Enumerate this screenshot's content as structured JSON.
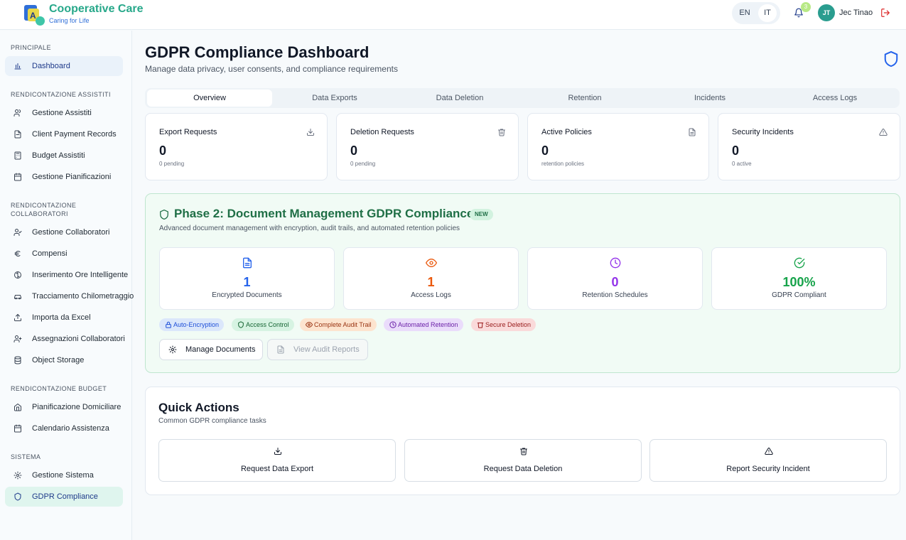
{
  "header": {
    "brand": "Cooperative Care",
    "tagline": "Caring for Life",
    "logo_letter": "A",
    "lang_en": "EN",
    "lang_it": "IT",
    "notification_count": "3",
    "user_initials": "JT",
    "user_name": "Jec Tinao"
  },
  "sidebar": {
    "sections": [
      {
        "label": "PRINCIPALE"
      },
      {
        "label": "RENDICONTAZIONE ASSISTITI"
      },
      {
        "label": "RENDICONTAZIONE COLLABORATORI"
      },
      {
        "label": "RENDICONTAZIONE BUDGET"
      },
      {
        "label": "SISTEMA"
      }
    ],
    "items": [
      {
        "label": "Dashboard",
        "icon": "bar-chart-icon"
      },
      {
        "label": "Gestione Assistiti",
        "icon": "users-icon"
      },
      {
        "label": "Client Payment Records",
        "icon": "file-icon"
      },
      {
        "label": "Budget Assistiti",
        "icon": "calculator-icon"
      },
      {
        "label": "Gestione Pianificazioni",
        "icon": "calendar-icon"
      },
      {
        "label": "Gestione Collaboratori",
        "icon": "user-check-icon"
      },
      {
        "label": "Compensi",
        "icon": "euro-icon"
      },
      {
        "label": "Inserimento Ore Intelligente",
        "icon": "brain-icon"
      },
      {
        "label": "Tracciamento Chilometraggio",
        "icon": "car-icon"
      },
      {
        "label": "Importa da Excel",
        "icon": "upload-icon"
      },
      {
        "label": "Assegnazioni Collaboratori",
        "icon": "user-plus-icon"
      },
      {
        "label": "Object Storage",
        "icon": "database-icon"
      },
      {
        "label": "Pianificazione Domiciliare",
        "icon": "home-icon"
      },
      {
        "label": "Calendario Assistenza",
        "icon": "calendar-icon"
      },
      {
        "label": "Gestione Sistema",
        "icon": "gear-icon"
      },
      {
        "label": "GDPR Compliance",
        "icon": "shield-icon"
      }
    ]
  },
  "page": {
    "title": "GDPR Compliance Dashboard",
    "subtitle": "Manage data privacy, user consents, and compliance requirements"
  },
  "tabs": [
    {
      "label": "Overview"
    },
    {
      "label": "Data Exports"
    },
    {
      "label": "Data Deletion"
    },
    {
      "label": "Retention"
    },
    {
      "label": "Incidents"
    },
    {
      "label": "Access Logs"
    }
  ],
  "stats": [
    {
      "title": "Export Requests",
      "value": "0",
      "sub": "0 pending",
      "icon": "download-icon"
    },
    {
      "title": "Deletion Requests",
      "value": "0",
      "sub": "0 pending",
      "icon": "trash-icon"
    },
    {
      "title": "Active Policies",
      "value": "0",
      "sub": "retention policies",
      "icon": "file-text-icon"
    },
    {
      "title": "Security Incidents",
      "value": "0",
      "sub": "0 active",
      "icon": "alert-triangle-icon"
    }
  ],
  "phase": {
    "title": "Phase 2: Document Management GDPR Compliance",
    "badge": "NEW",
    "subtitle": "Advanced document management with encryption, audit trails, and automated retention policies",
    "metrics": [
      {
        "value": "1",
        "label": "Encrypted Documents",
        "color": "#2563eb",
        "icon": "file-text-icon"
      },
      {
        "value": "1",
        "label": "Access Logs",
        "color": "#ea580c",
        "icon": "eye-icon"
      },
      {
        "value": "0",
        "label": "Retention Schedules",
        "color": "#9333ea",
        "icon": "clock-icon"
      },
      {
        "value": "100%",
        "label": "GDPR Compliant",
        "color": "#16a34a",
        "icon": "check-circle-icon"
      }
    ],
    "chips": [
      {
        "label": "Auto-Encryption",
        "icon": "lock-icon"
      },
      {
        "label": "Access Control",
        "icon": "shield-icon"
      },
      {
        "label": "Complete Audit Trail",
        "icon": "eye-icon"
      },
      {
        "label": "Automated Retention",
        "icon": "clock-icon"
      },
      {
        "label": "Secure Deletion",
        "icon": "trash-icon"
      }
    ],
    "manage_button": "Manage Documents",
    "audit_button": "View Audit Reports"
  },
  "quick_actions": {
    "title": "Quick Actions",
    "subtitle": "Common GDPR compliance tasks",
    "actions": [
      {
        "label": "Request Data Export",
        "icon": "download-icon"
      },
      {
        "label": "Request Data Deletion",
        "icon": "trash-icon"
      },
      {
        "label": "Report Security Incident",
        "icon": "alert-triangle-icon"
      }
    ]
  }
}
